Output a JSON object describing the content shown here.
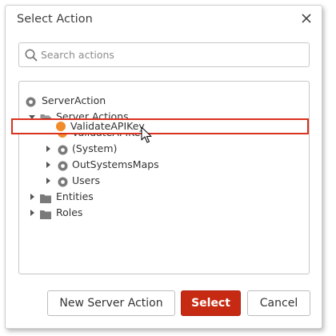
{
  "dialog": {
    "title": "Select Action",
    "close_icon": "close-icon"
  },
  "search": {
    "placeholder": "Search actions",
    "value": "",
    "icon": "search-icon"
  },
  "tree": {
    "root": {
      "label": "ServerAction",
      "icon": "gear-icon"
    },
    "server_actions": {
      "label": "Server Actions",
      "icon": "folder-open-icon",
      "expanded": true
    },
    "validate": {
      "label": "ValidateAPIKey",
      "icon": "orange-dot-icon",
      "selected": true,
      "dot_color": "#f28b2a"
    },
    "system": {
      "label": "(System)",
      "icon": "gear-icon",
      "expanded": false
    },
    "outsystemsmaps": {
      "label": "OutSystemsMaps",
      "icon": "gear-icon",
      "expanded": false
    },
    "users": {
      "label": "Users",
      "icon": "gear-icon",
      "expanded": false
    },
    "entities": {
      "label": "Entities",
      "icon": "folder-icon",
      "expanded": false
    },
    "roles": {
      "label": "Roles",
      "icon": "folder-icon",
      "expanded": false
    }
  },
  "buttons": {
    "new_server_action": "New Server Action",
    "select": "Select",
    "cancel": "Cancel"
  },
  "colors": {
    "primary": "#c72a12",
    "selection_border": "#d9321e",
    "accent_dot": "#f28b2a"
  }
}
